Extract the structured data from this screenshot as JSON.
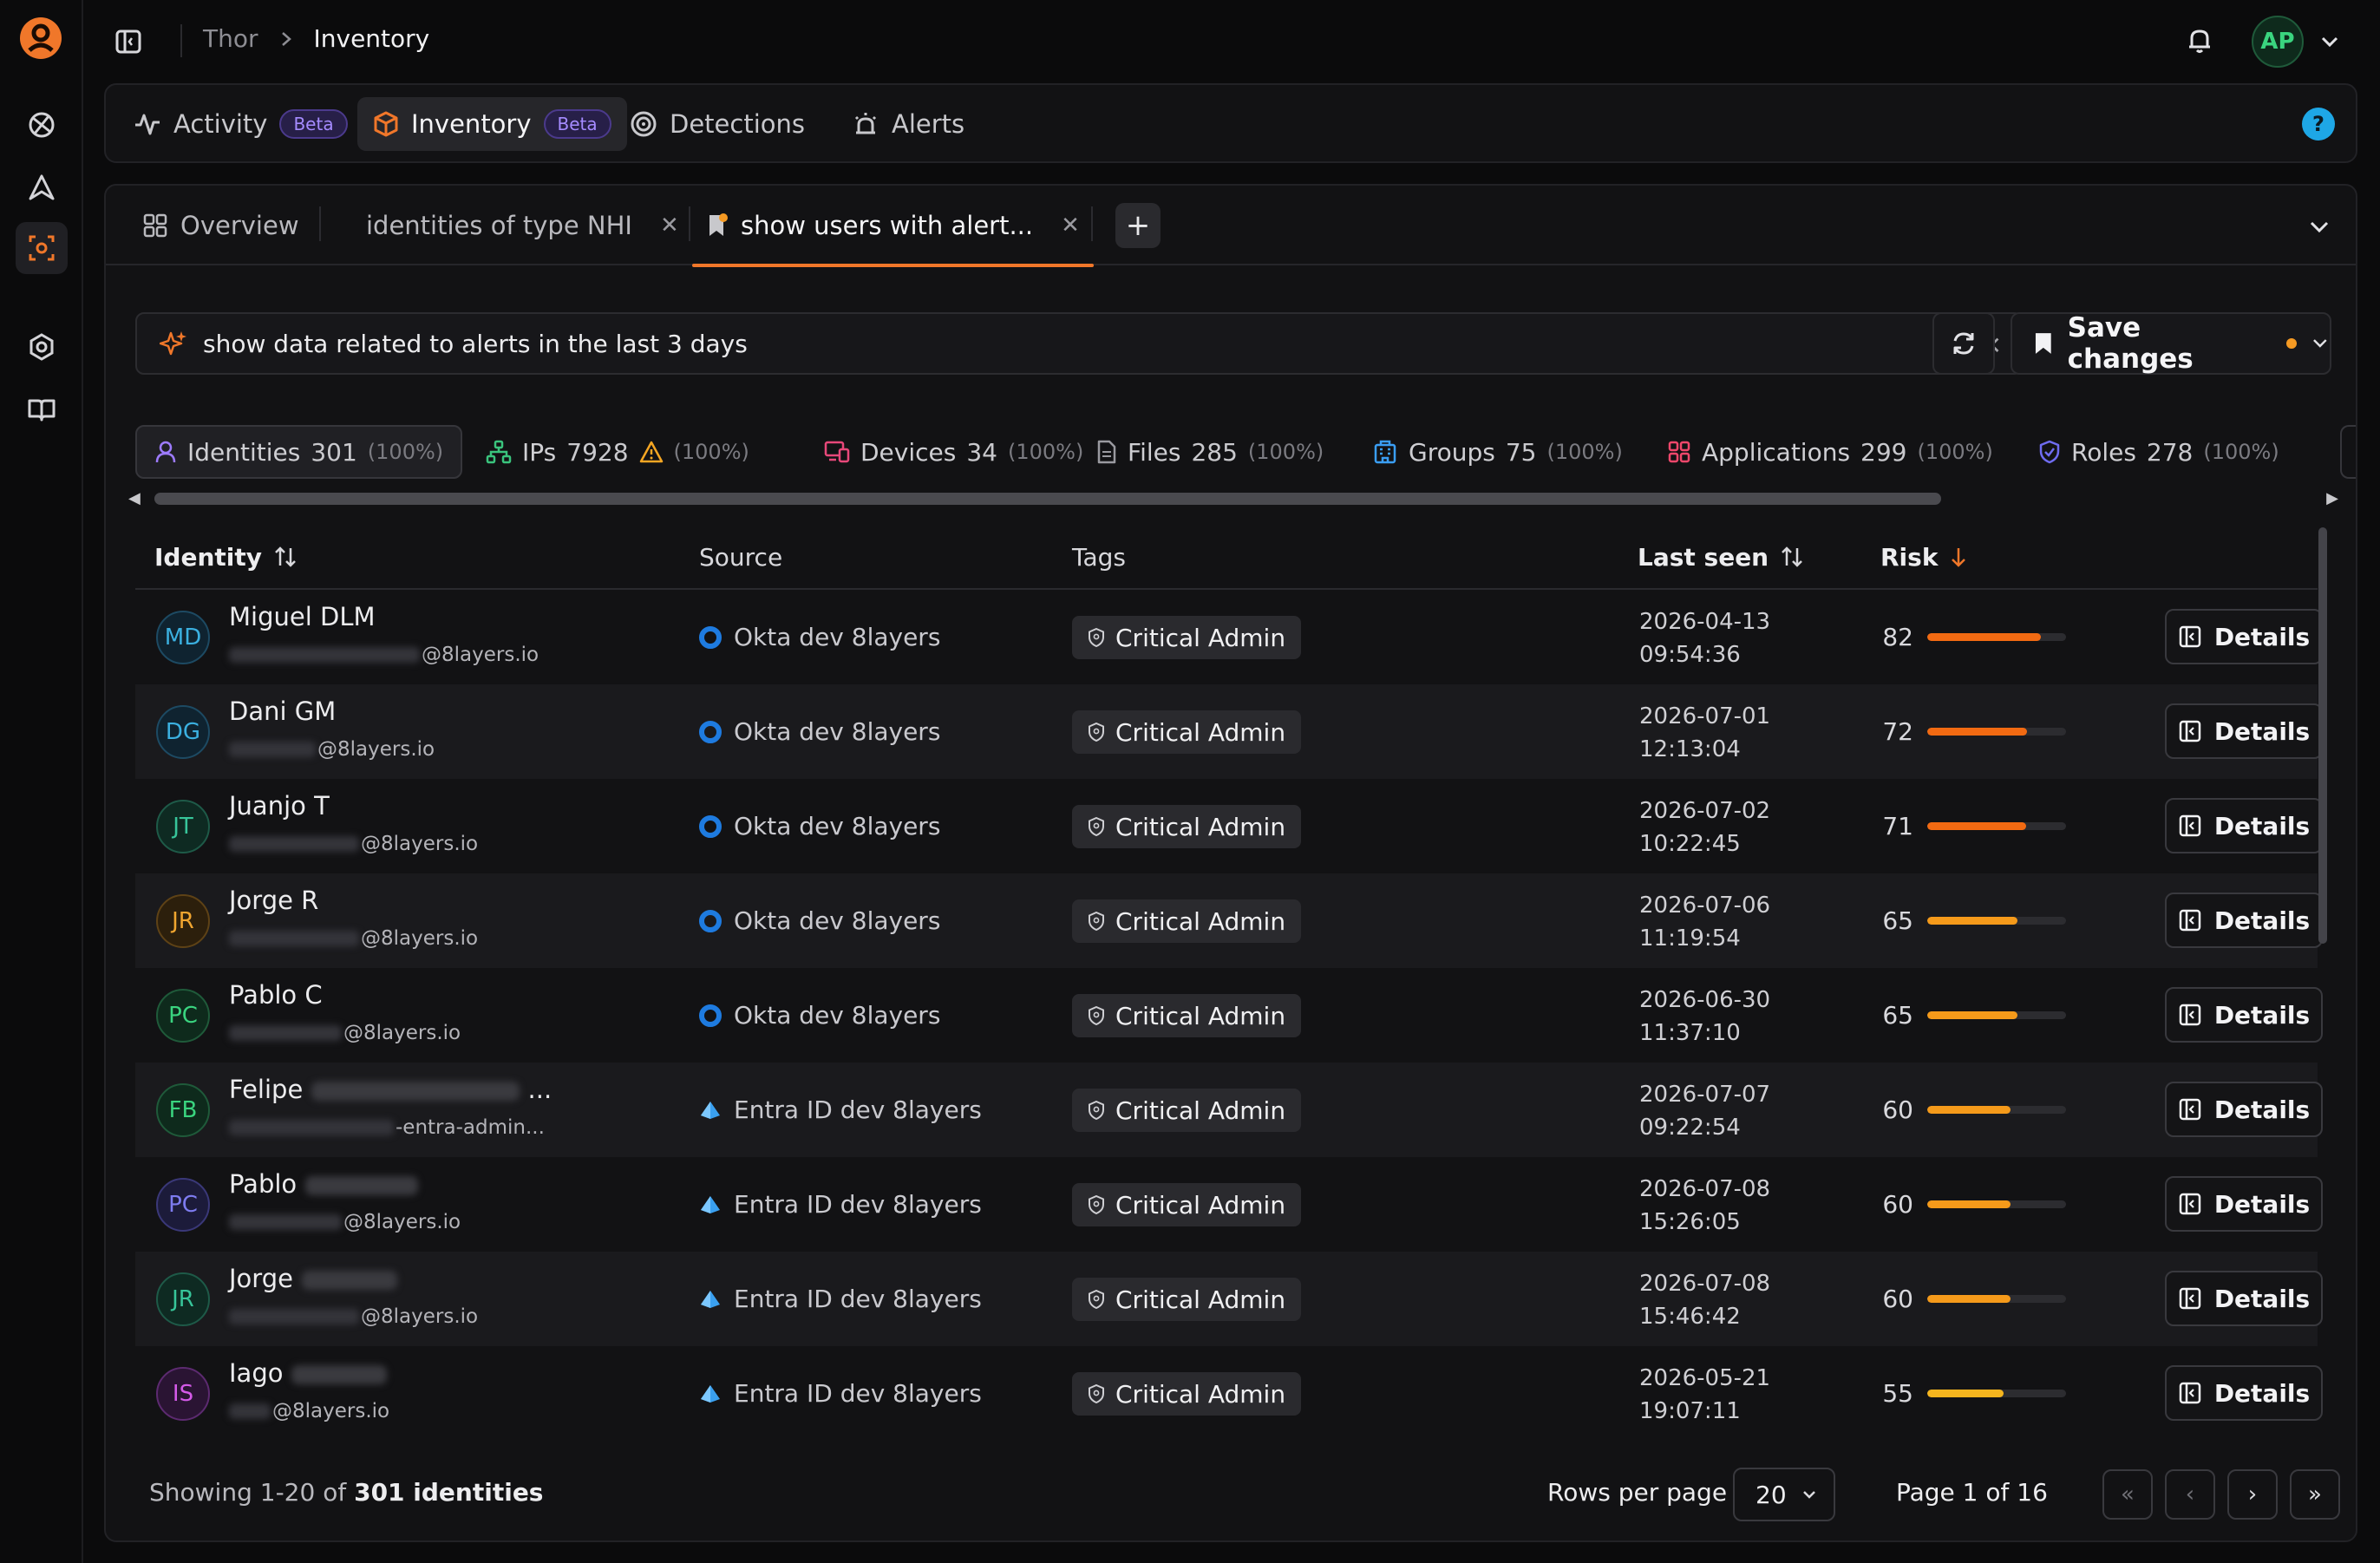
{
  "breadcrumb": {
    "root": "Thor",
    "current": "Inventory"
  },
  "user": {
    "initials": "AP"
  },
  "nav": {
    "tabs": [
      {
        "label": "Activity",
        "badge": "Beta"
      },
      {
        "label": "Inventory",
        "badge": "Beta"
      },
      {
        "label": "Detections"
      },
      {
        "label": "Alerts"
      }
    ],
    "help": "?"
  },
  "query_tabs": [
    {
      "label": "Overview"
    },
    {
      "label": "identities of type NHI"
    },
    {
      "label": "show users with alert..."
    }
  ],
  "search": {
    "value": "show data related to alerts in the last 3 days"
  },
  "save": {
    "label": "Save changes"
  },
  "entity_tabs": [
    {
      "label": "Identities",
      "count": "301",
      "pct": "(100%)"
    },
    {
      "label": "IPs",
      "count": "7928",
      "pct": "(100%)"
    },
    {
      "label": "Devices",
      "count": "34",
      "pct": "(100%)"
    },
    {
      "label": "Files",
      "count": "285",
      "pct": "(100%)"
    },
    {
      "label": "Groups",
      "count": "75",
      "pct": "(100%)"
    },
    {
      "label": "Applications",
      "count": "299",
      "pct": "(100%)"
    },
    {
      "label": "Roles",
      "count": "278",
      "pct": "(100%)"
    }
  ],
  "table": {
    "headers": {
      "identity": "Identity",
      "source": "Source",
      "tags": "Tags",
      "last_seen": "Last seen",
      "risk": "Risk"
    },
    "details_label": "Details",
    "rows": [
      {
        "initials": "MD",
        "name": "Miguel DLM",
        "email": "@8layers.io",
        "source": "Okta dev 8layers",
        "tag": "Critical Admin",
        "date": "2026-04-13",
        "time": "09:54:36",
        "risk": "82"
      },
      {
        "initials": "DG",
        "name": "Dani GM",
        "email": "@8layers.io",
        "source": "Okta dev 8layers",
        "tag": "Critical Admin",
        "date": "2026-07-01",
        "time": "12:13:04",
        "risk": "72"
      },
      {
        "initials": "JT",
        "name": "Juanjo T",
        "email": "@8layers.io",
        "source": "Okta dev 8layers",
        "tag": "Critical Admin",
        "date": "2026-07-02",
        "time": "10:22:45",
        "risk": "71"
      },
      {
        "initials": "JR",
        "name": "Jorge R",
        "email": "@8layers.io",
        "source": "Okta dev 8layers",
        "tag": "Critical Admin",
        "date": "2026-07-06",
        "time": "11:19:54",
        "risk": "65"
      },
      {
        "initials": "PC",
        "name": "Pablo C",
        "email": "@8layers.io",
        "source": "Okta dev 8layers",
        "tag": "Critical Admin",
        "date": "2026-06-30",
        "time": "11:37:10",
        "risk": "65"
      },
      {
        "initials": "FB",
        "name": "Felipe",
        "name_suffix": "...",
        "email": "-entra-admin...",
        "source": "Entra ID dev 8layers",
        "tag": "Critical Admin",
        "date": "2026-07-07",
        "time": "09:22:54",
        "risk": "60"
      },
      {
        "initials": "PC",
        "name": "Pablo",
        "email": "@8layers.io",
        "source": "Entra ID dev 8layers",
        "tag": "Critical Admin",
        "date": "2026-07-08",
        "time": "15:26:05",
        "risk": "60"
      },
      {
        "initials": "JR",
        "name": "Jorge",
        "email": "@8layers.io",
        "source": "Entra ID dev 8layers",
        "tag": "Critical Admin",
        "date": "2026-07-08",
        "time": "15:46:42",
        "risk": "60"
      },
      {
        "initials": "IS",
        "name": "Iago",
        "email": "@8layers.io",
        "source": "Entra ID dev 8layers",
        "tag": "Critical Admin",
        "date": "2026-05-21",
        "time": "19:07:11",
        "risk": "55"
      }
    ]
  },
  "footer": {
    "showing_prefix": "Showing 1-20 of",
    "showing_bold": "301 identities",
    "rows_per_page_label": "Rows per page",
    "rows_per_page": "20",
    "page_info": "Page 1 of 16"
  },
  "colors": {
    "accent": "#f0772a",
    "risk_high": "#f26a12",
    "risk_mid": "#f59a1a",
    "risk_low": "#f5b51e",
    "okta": "#1e7be0",
    "entra": "#3aa0f0"
  }
}
